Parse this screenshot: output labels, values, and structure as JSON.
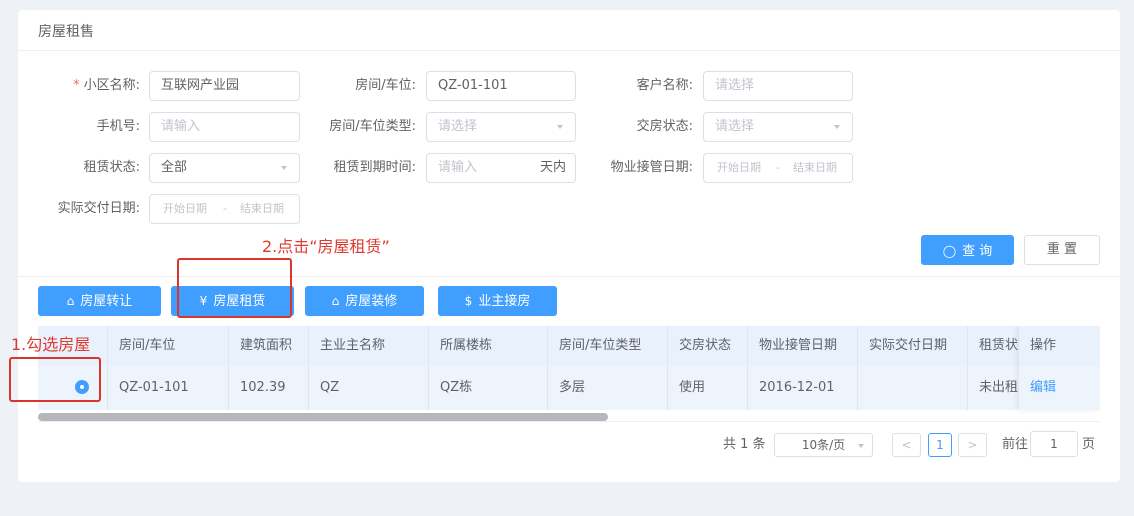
{
  "card": {
    "title": "房屋租售"
  },
  "form": {
    "required_mark": "*",
    "community_label": "小区名称:",
    "community_value": "互联网产业园",
    "room_label": "房间/车位:",
    "room_value": "QZ-01-101",
    "customer_label": "客户名称:",
    "customer_placeholder": "请选择",
    "phone_label": "手机号:",
    "phone_placeholder": "请输入",
    "room_type_label": "房间/车位类型:",
    "room_type_placeholder": "请选择",
    "delivery_status_label": "交房状态:",
    "delivery_status_placeholder": "请选择",
    "lease_status_label": "租赁状态:",
    "lease_status_value": "全部",
    "lease_expire_label": "租赁到期时间:",
    "lease_expire_placeholder": "请输入",
    "lease_expire_suffix": "天内",
    "takeover_date_label": "物业接管日期:",
    "takeover_start": "开始日期",
    "takeover_sep": "-",
    "takeover_end": "结束日期",
    "actual_delivery_label": "实际交付日期:",
    "actual_start": "开始日期",
    "actual_sep": "-",
    "actual_end": "结束日期",
    "query_button": "查 询",
    "reset_button": "重 置"
  },
  "actions": {
    "transfer": "房屋转让",
    "lease": "房屋租赁",
    "decorate": "房屋装修",
    "owner_takeover": "业主接房"
  },
  "table": {
    "headers": [
      "房间/车位",
      "建筑面积",
      "主业主名称",
      "所属楼栋",
      "房间/车位类型",
      "交房状态",
      "物业接管日期",
      "实际交付日期",
      "租赁状态",
      "操作"
    ],
    "rows": [
      {
        "room": "QZ-01-101",
        "area": "102.39",
        "owner": "QZ",
        "building": "QZ栋",
        "type": "多层",
        "delivery": "使用",
        "takeover": "2016-12-01",
        "actual": "",
        "lease": "未出租",
        "op": "编辑"
      }
    ]
  },
  "pagination": {
    "total": "共 1 条",
    "page_size": "10条/页",
    "prev": "<",
    "current": "1",
    "next": ">",
    "goto_label": "前往",
    "goto_value": "1",
    "page_suffix": "页"
  },
  "annotations": {
    "step1": "1.勾选房屋",
    "step2": "2.点击“房屋租赁”"
  },
  "colors": {
    "primary": "#409eff",
    "annotation": "#e03a2f"
  }
}
